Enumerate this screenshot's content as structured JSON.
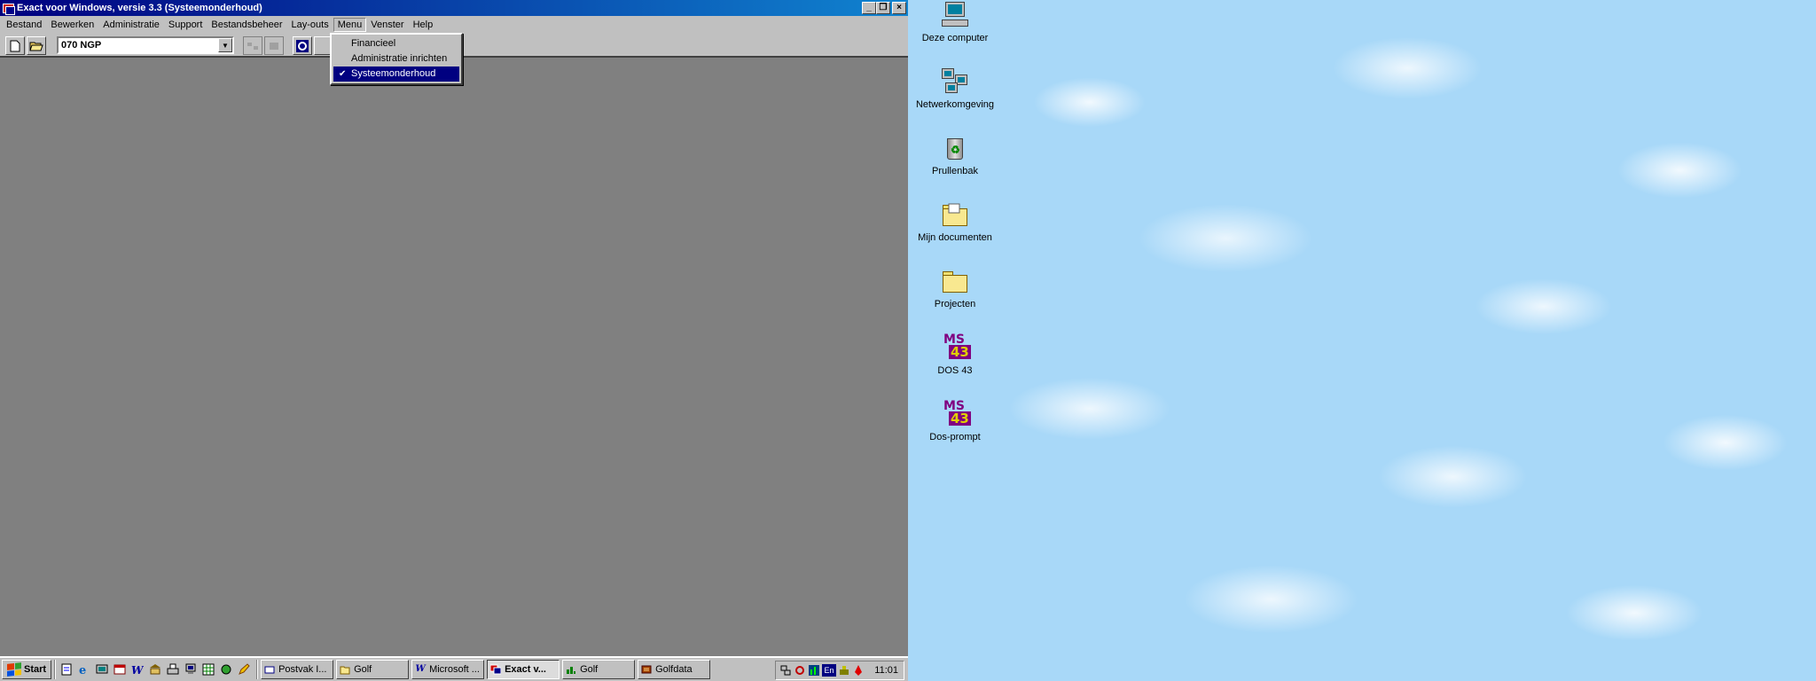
{
  "app": {
    "title": "Exact voor Windows, versie 3.3 (Systeemonderhoud)",
    "window_buttons": [
      "_",
      "❐",
      "×"
    ]
  },
  "menubar": {
    "items": [
      "Bestand",
      "Bewerken",
      "Administratie",
      "Support",
      "Bestandsbeheer",
      "Lay-outs",
      "Menu",
      "Venster",
      "Help"
    ],
    "open_item": "Menu"
  },
  "toolbar": {
    "combo_value": "070 NGP",
    "combo_arrow": "▼"
  },
  "dropdown": {
    "items": [
      {
        "label": "Financieel",
        "checked": false
      },
      {
        "label": "Administratie inrichten",
        "checked": false
      },
      {
        "label": "Systeemonderhoud",
        "checked": true
      }
    ],
    "check_glyph": "✔"
  },
  "taskbar": {
    "start_label": "Start",
    "tasks": [
      {
        "label": "Postvak I...",
        "icon": "inbox-icon",
        "active": false
      },
      {
        "label": "Golf",
        "icon": "folder-icon",
        "active": false
      },
      {
        "label": "Microsoft ...",
        "icon": "word-icon",
        "active": false
      },
      {
        "label": "Exact v...",
        "icon": "exact-icon",
        "active": true
      },
      {
        "label": "Golf",
        "icon": "chart-icon",
        "active": false
      },
      {
        "label": "Golfdata",
        "icon": "database-icon",
        "active": false
      }
    ],
    "tray_lang": "En",
    "clock": "11:01"
  },
  "desktop": {
    "icons": [
      {
        "label": "Deze computer",
        "icon": "computer-icon"
      },
      {
        "label": "Netwerkomgeving",
        "icon": "network-icon"
      },
      {
        "label": "Prullenbak",
        "icon": "recycle-bin-icon"
      },
      {
        "label": "Mijn documenten",
        "icon": "documents-folder-icon"
      },
      {
        "label": "Projecten",
        "icon": "folder-icon"
      },
      {
        "label": "DOS 43",
        "icon": "msdos-icon"
      },
      {
        "label": "Dos-prompt",
        "icon": "msdos-icon"
      }
    ],
    "msdos_glyph_top": "MS",
    "msdos_glyph_bottom": "43"
  },
  "colors": {
    "titlebar_start": "#000080",
    "titlebar_end": "#1084d0",
    "face": "#c0c0c0",
    "workspace": "#808080",
    "highlight": "#000080",
    "desktop_sky": "#a8d8f8"
  }
}
